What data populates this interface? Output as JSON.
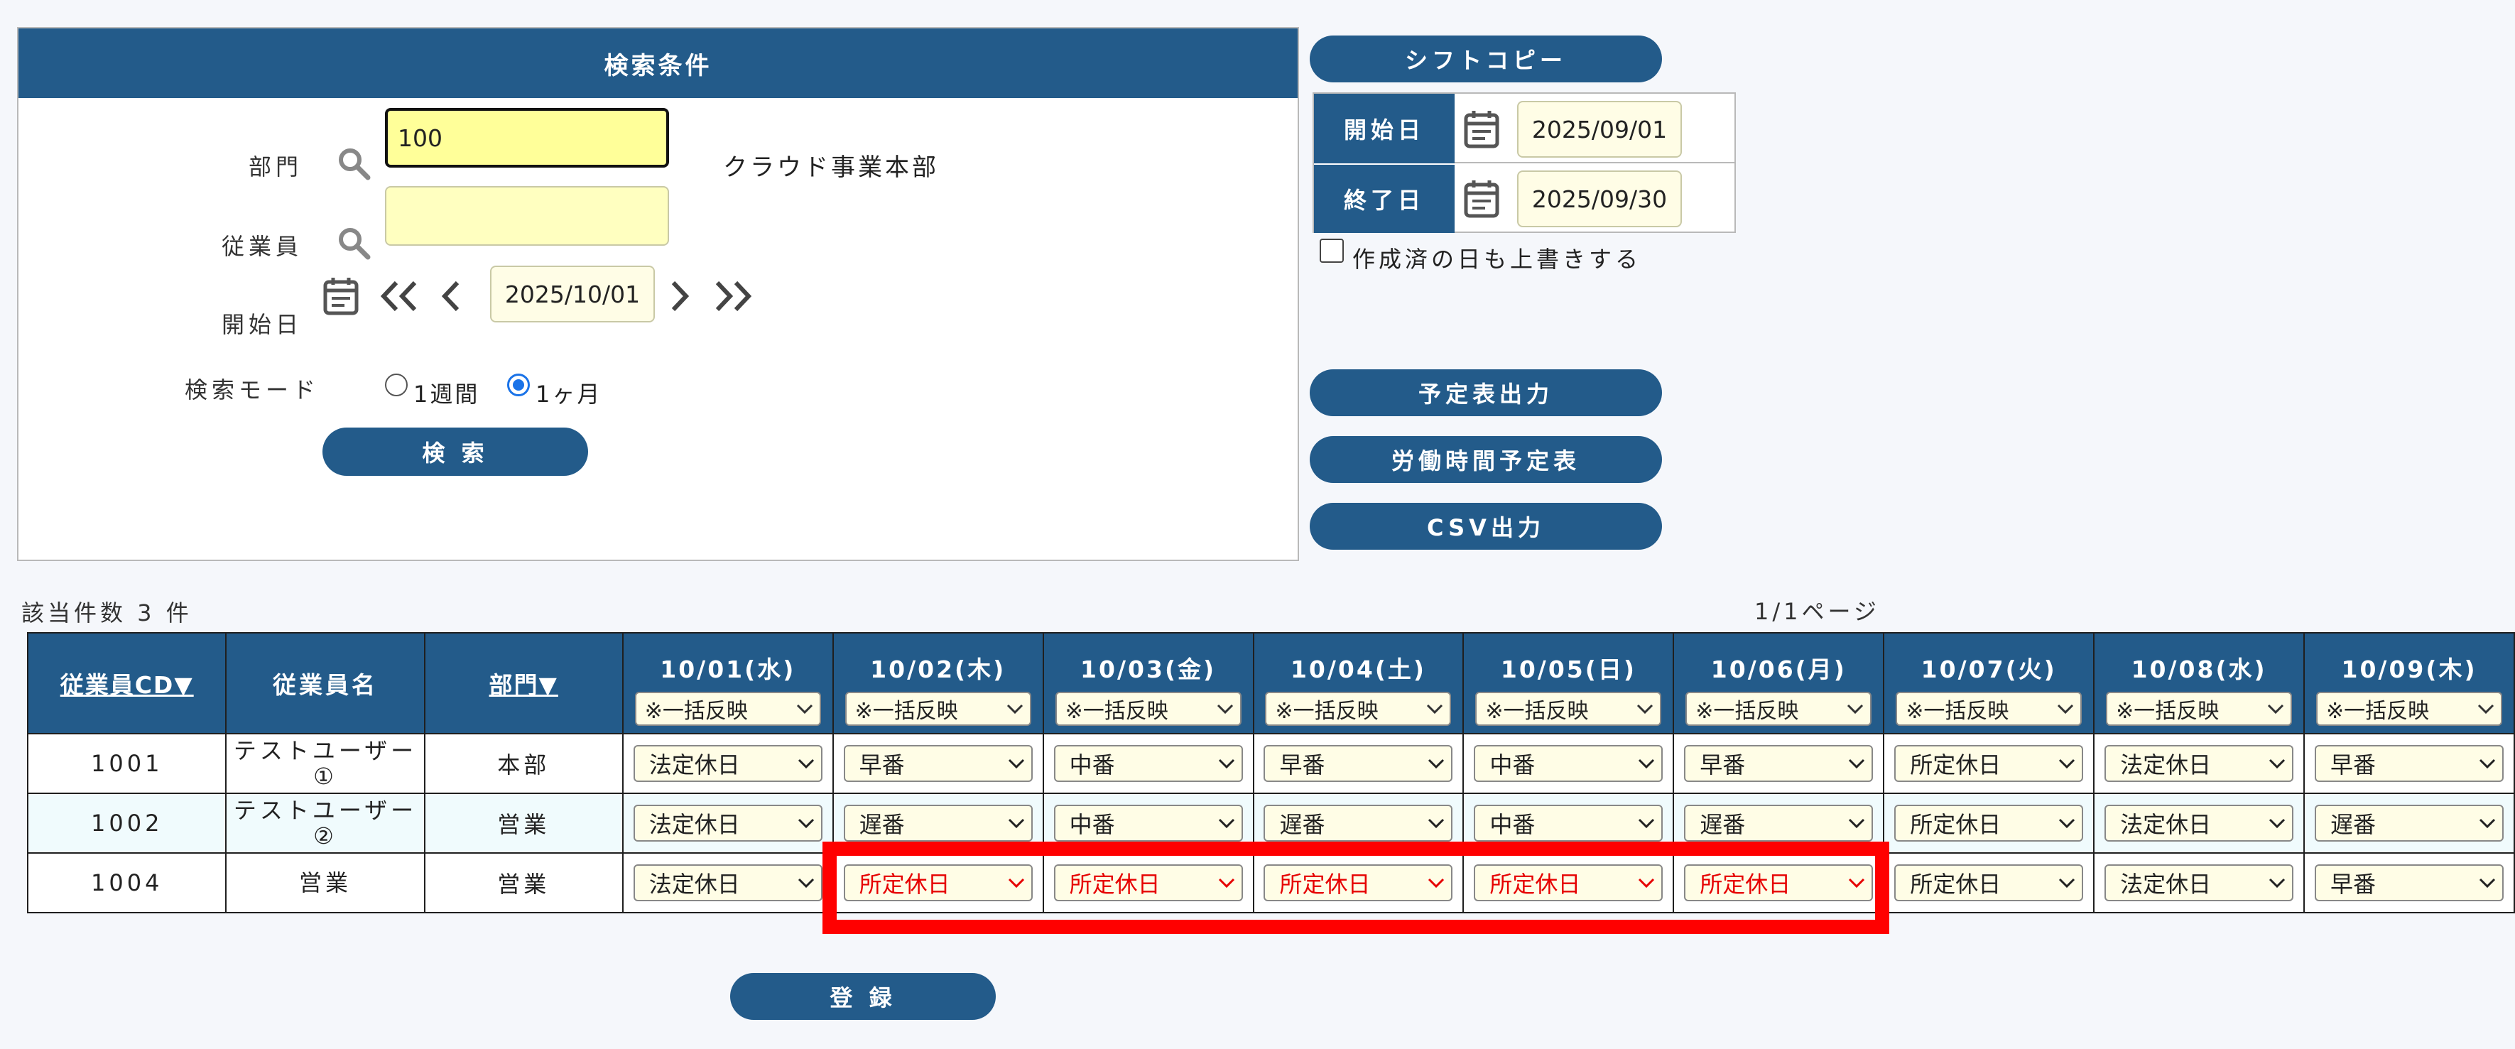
{
  "search": {
    "header": "検索条件",
    "dept_label": "部門",
    "dept_value": "100",
    "dept_name": "クラウド事業本部",
    "employee_label": "従業員",
    "employee_value": "",
    "start_label": "開始日",
    "start_value": "2025/10/01",
    "mode_label": "検索モード",
    "mode_week": "1週間",
    "mode_month": "1ヶ月",
    "mode_selected": "1ヶ月",
    "search_button": "検 索"
  },
  "shift_copy": {
    "button": "シフトコピー",
    "start_label": "開始日",
    "start_value": "2025/09/01",
    "end_label": "終了日",
    "end_value": "2025/09/30",
    "overwrite_label": "作成済の日も上書きする"
  },
  "actions": {
    "schedule_output": "予定表出力",
    "labor_schedule": "労働時間予定表",
    "csv_output": "CSV出力"
  },
  "results": {
    "count_text": "該当件数 3 件",
    "page_text": "1/1ページ"
  },
  "table": {
    "col_emp_cd": "従業員CD▼",
    "col_emp_name": "従業員名",
    "col_dept": "部門▼",
    "bulk_label": "※一括反映",
    "days": [
      "10/01(水)",
      "10/02(木)",
      "10/03(金)",
      "10/04(土)",
      "10/05(日)",
      "10/06(月)",
      "10/07(火)",
      "10/08(水)",
      "10/09(木)"
    ],
    "rows": [
      {
        "cd": "1001",
        "name": "テストユーザー①",
        "dept": "本部",
        "shifts": [
          "法定休日",
          "早番",
          "中番",
          "早番",
          "中番",
          "早番",
          "所定休日",
          "法定休日",
          "早番"
        ]
      },
      {
        "cd": "1002",
        "name": "テストユーザー②",
        "dept": "営業",
        "shifts": [
          "法定休日",
          "遅番",
          "中番",
          "遅番",
          "中番",
          "遅番",
          "所定休日",
          "法定休日",
          "遅番"
        ]
      },
      {
        "cd": "1004",
        "name": "営業",
        "dept": "営業",
        "shifts": [
          "法定休日",
          "所定休日",
          "所定休日",
          "所定休日",
          "所定休日",
          "所定休日",
          "所定休日",
          "法定休日",
          "早番"
        ]
      }
    ],
    "highlight_color": "#e60000"
  },
  "register_button": "登 録"
}
